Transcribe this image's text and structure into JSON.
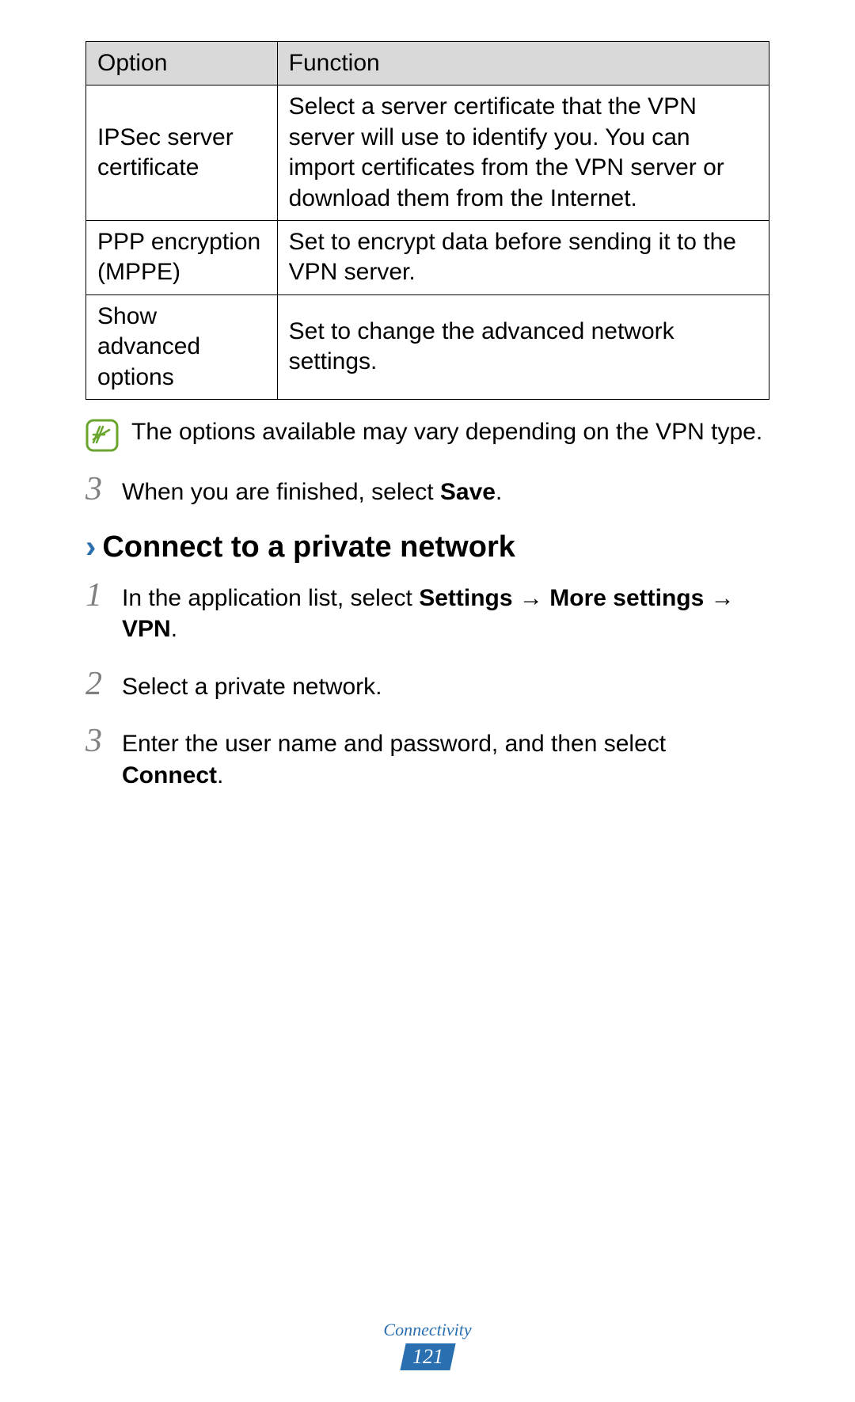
{
  "table": {
    "headers": {
      "option": "Option",
      "function": "Function"
    },
    "rows": [
      {
        "option": "IPSec server certificate",
        "function": "Select a server certificate that the VPN server will use to identify you. You can import certificates from the VPN server or download them from the Internet."
      },
      {
        "option": "PPP encryption (MPPE)",
        "function": "Set to encrypt data before sending it to the VPN server."
      },
      {
        "option": "Show advanced options",
        "function": "Set to change the advanced network settings."
      }
    ]
  },
  "note": {
    "text": "The options available may vary depending on the VPN type."
  },
  "step_top": {
    "number": "3",
    "text_prefix": "When you are finished, select ",
    "bold": "Save",
    "suffix": "."
  },
  "heading": {
    "chevron": "›",
    "text": "Connect to a private network"
  },
  "steps": {
    "s1": {
      "number": "1",
      "prefix": "In the application list, select ",
      "b1": "Settings",
      "arrow1": " → ",
      "b2": "More settings",
      "arrow2": " → ",
      "b3": "VPN",
      "suffix": "."
    },
    "s2": {
      "number": "2",
      "text": "Select a private network."
    },
    "s3": {
      "number": "3",
      "prefix": "Enter the user name and password, and then select ",
      "bold": "Connect",
      "suffix": "."
    }
  },
  "footer": {
    "section": "Connectivity",
    "page": "121"
  }
}
